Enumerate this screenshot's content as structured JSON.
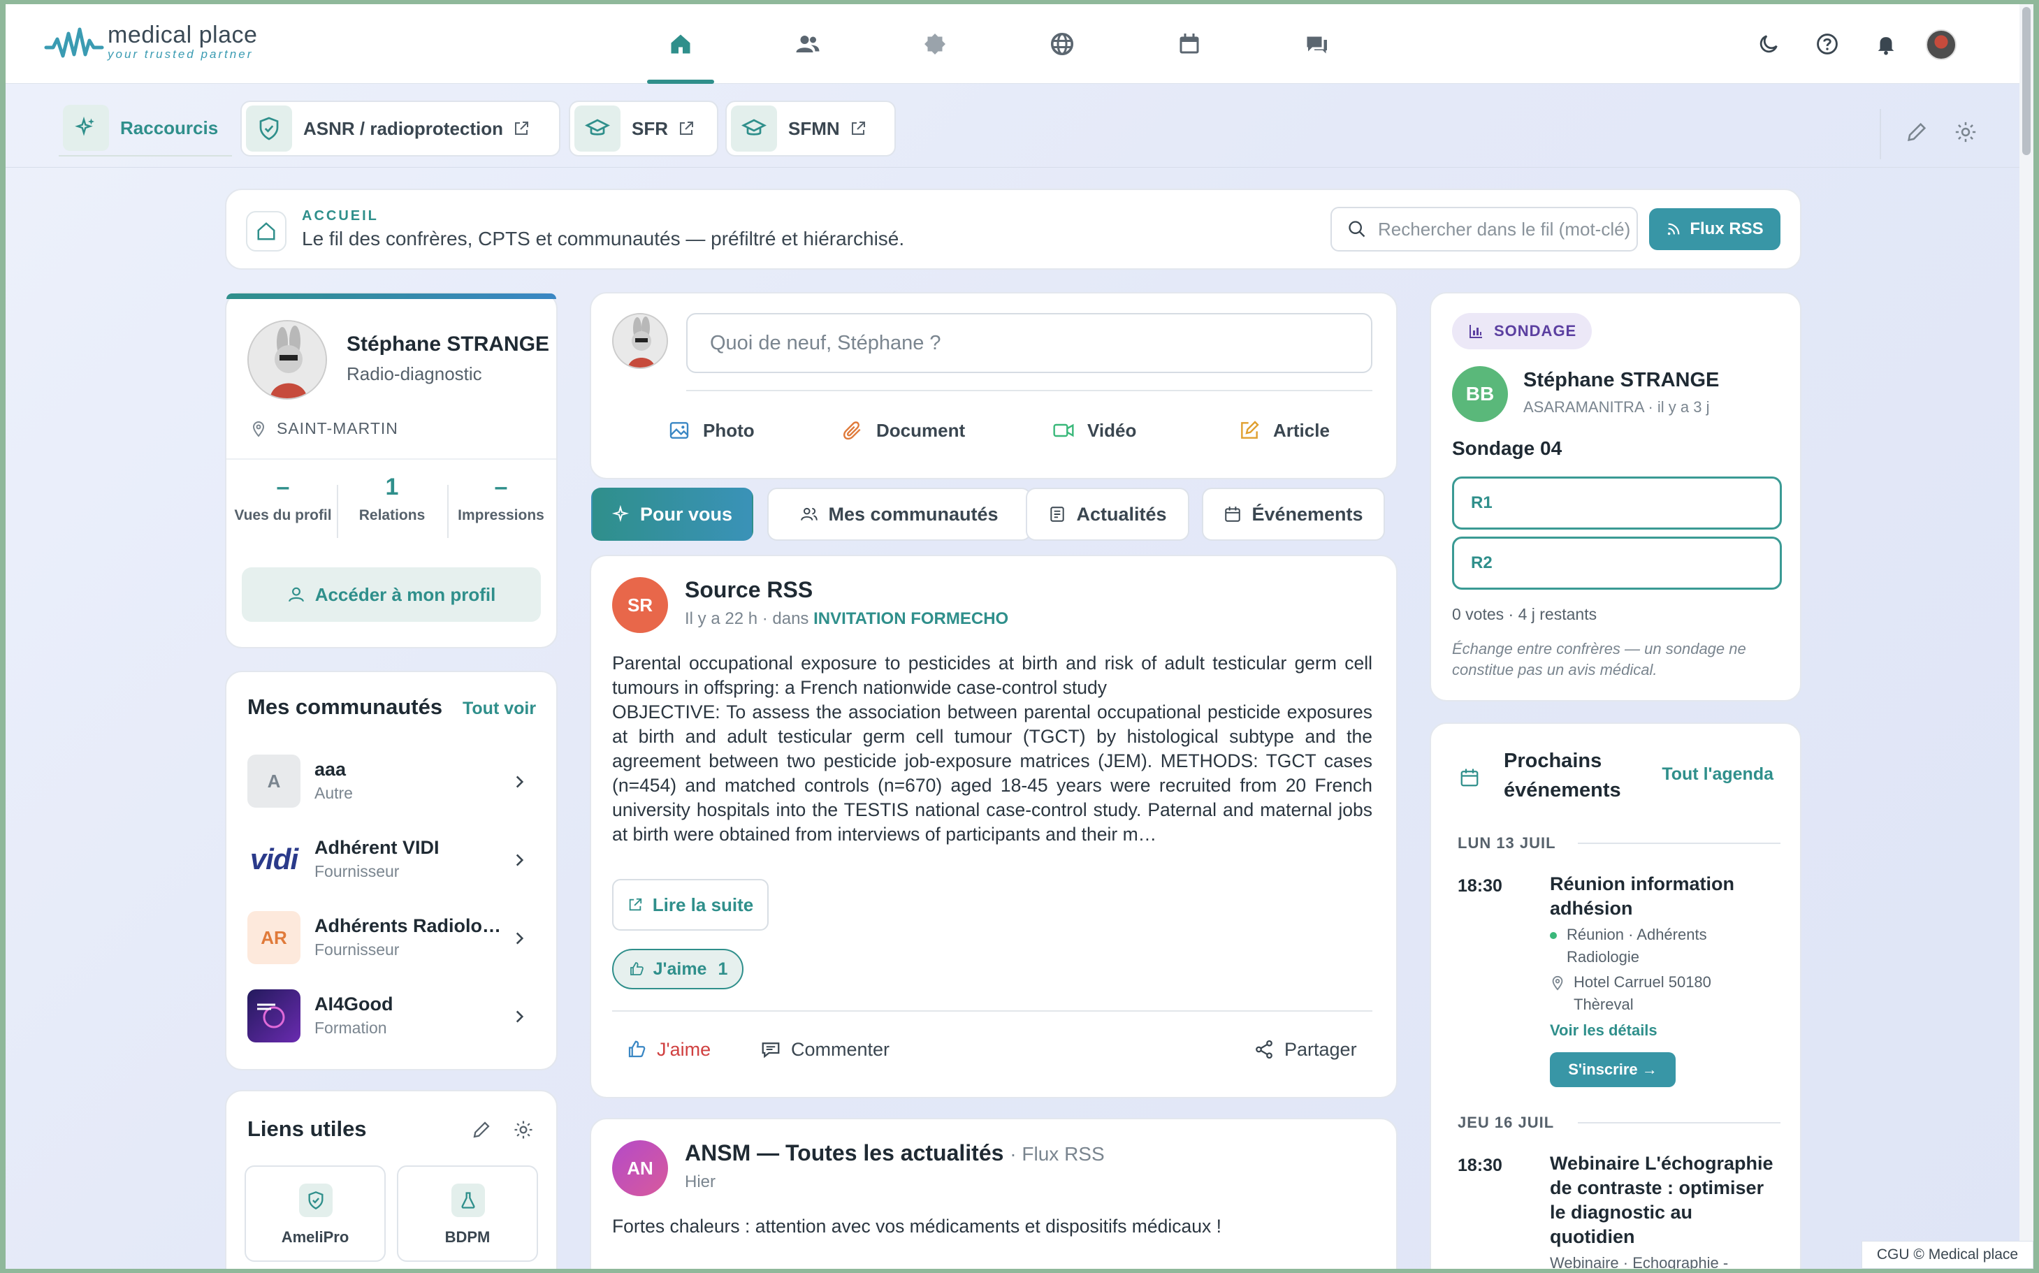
{
  "app": {
    "logo_name": "medical place",
    "logo_tagline": "your trusted partner"
  },
  "nav": {
    "items": [
      {
        "icon": "home-icon",
        "active": true
      },
      {
        "icon": "users-icon",
        "active": false
      },
      {
        "icon": "badge-icon",
        "active": false
      },
      {
        "icon": "globe-icon",
        "active": false
      },
      {
        "icon": "calendar-icon",
        "active": false
      },
      {
        "icon": "chat-icon",
        "active": false
      }
    ],
    "right_icons": [
      "moon-icon",
      "help-icon",
      "bell-icon",
      "avatar"
    ]
  },
  "shortcuts": {
    "title": "Raccourcis",
    "items": [
      {
        "label": "ASNR / radioprotection",
        "icon": "shield-icon"
      },
      {
        "label": "SFR",
        "icon": "graduation-cap-icon"
      },
      {
        "label": "SFMN",
        "icon": "graduation-cap-icon"
      }
    ]
  },
  "header": {
    "overline": "ACCUEIL",
    "subtitle": "Le fil des confrères, CPTS et communautés — préfiltré et hiérarchisé.",
    "search_placeholder": "Rechercher dans le fil (mot-clé)",
    "rss_button": "Flux RSS"
  },
  "profile": {
    "name": "Stéphane STRANGE",
    "specialty": "Radio-diagnostic",
    "location": "SAINT-MARTIN",
    "stats": [
      {
        "value": "–",
        "label": "Vues du profil"
      },
      {
        "value": "1",
        "label": "Relations"
      },
      {
        "value": "–",
        "label": "Impressions"
      }
    ],
    "button": "Accéder à mon profil"
  },
  "communities": {
    "title": "Mes communautés",
    "see_all": "Tout voir",
    "items": [
      {
        "initials": "A",
        "name": "aaa",
        "type": "Autre"
      },
      {
        "initials": "vidi",
        "name": "Adhérent VIDI",
        "type": "Fournisseur"
      },
      {
        "initials": "AR",
        "name": "Adhérents Radiologie",
        "type": "Fournisseur"
      },
      {
        "initials": "",
        "name": "AI4Good",
        "type": "Formation"
      }
    ]
  },
  "useful_links": {
    "title": "Liens utiles",
    "items": [
      {
        "label": "AmeliPro",
        "icon": "shield-check-icon"
      },
      {
        "label": "BDPM",
        "icon": "flask-icon"
      }
    ]
  },
  "composer": {
    "placeholder": "Quoi de neuf, Stéphane ?",
    "actions": [
      "Photo",
      "Document",
      "Vidéo",
      "Article"
    ]
  },
  "tabs": [
    "Pour vous",
    "Mes communautés",
    "Actualités",
    "Événements"
  ],
  "posts": [
    {
      "initials": "SR",
      "author": "Source RSS",
      "time": "Il y a 22 h · dans",
      "community": "INVITATION FORMECHO",
      "title_text": "Parental occupational exposure to pesticides at birth and risk of adult testicular germ cell tumours in offspring: a French nationwide case-control study",
      "body": "OBJECTIVE: To assess the association between parental occupational pesticide exposures at birth and adult testicular germ cell tumour (TGCT) by histological subtype and the agreement between two pesticide job-exposure matrices (JEM). METHODS: TGCT cases (n=454) and matched controls (n=670) aged 18-45 years were recruited from 20 French university hospitals into the TESTIS national case-control study. Paternal and maternal jobs at birth were obtained from interviews of participants and their m…",
      "read_more": "Lire la suite",
      "like_label": "J'aime",
      "like_count": "1",
      "actions": [
        "J'aime",
        "Commenter",
        "Partager"
      ]
    },
    {
      "initials": "AN",
      "author": "ANSM — Toutes les actualités",
      "source": "· Flux RSS",
      "time": "Hier",
      "body": "Fortes chaleurs : attention avec vos médicaments et dispositifs médicaux !"
    }
  ],
  "poll": {
    "badge": "SONDAGE",
    "initials": "BB",
    "author": "Stéphane STRANGE",
    "meta": "ASARAMANITRA · il y a 3 j",
    "question": "Sondage 04",
    "options": [
      "R1",
      "R2"
    ],
    "votes": "0 votes · 4 j restants",
    "note": "Échange entre confrères — un sondage ne constitue pas un avis médical."
  },
  "events": {
    "title": "Prochains événements",
    "see_all": "Tout l'agenda",
    "days": [
      {
        "label": "LUN 13 JUIL",
        "time": "18:30",
        "name": "Réunion information adhésion",
        "category": "Réunion · Adhérents Radiologie",
        "place": "Hotel Carruel 50180 Thèreval",
        "details": "Voir les détails",
        "register": "S'inscrire →"
      },
      {
        "label": "JEU 16 JUIL",
        "time": "18:30",
        "name": "Webinaire L'échographie de contraste : optimiser le diagnostic au quotidien",
        "category": "Webinaire · Echographie -"
      }
    ]
  },
  "footer": "CGU © Medical place"
}
